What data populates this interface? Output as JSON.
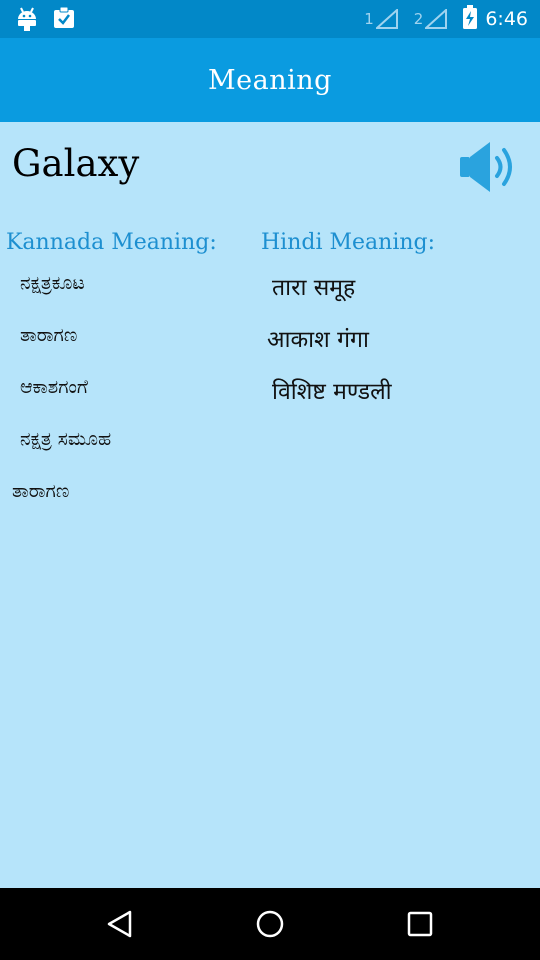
{
  "status_bar": {
    "sim1_label": "1",
    "sim2_label": "2",
    "time": "6:46"
  },
  "header": {
    "title": "Meaning"
  },
  "word": {
    "text": "Galaxy"
  },
  "kannada": {
    "heading": "Kannada Meaning:",
    "items": [
      "ನಕ್ಷತ್ರಕೂಟ",
      "ತಾರಾಗಣ",
      "ಆಕಾಶಗಂಗೆ",
      "ನಕ್ಷತ್ರ ಸಮೂಹ",
      "ತಾರಾಗಣ"
    ]
  },
  "hindi": {
    "heading": "Hindi Meaning:",
    "items": [
      "तारा समूह",
      "आकाश गंगा",
      "विशिष्ट मण्डली"
    ]
  },
  "colors": {
    "status_bar": "#0288c8",
    "app_bar": "#0a9be0",
    "background": "#b6e4fa",
    "heading_text": "#1d8fd0",
    "speaker": "#2aa3de"
  },
  "icons": {
    "status_left": [
      "android-icon",
      "clipboard-check-icon"
    ],
    "speaker": "speaker-volume-icon",
    "nav": [
      "back-triangle-icon",
      "home-circle-icon",
      "recents-square-icon"
    ]
  }
}
